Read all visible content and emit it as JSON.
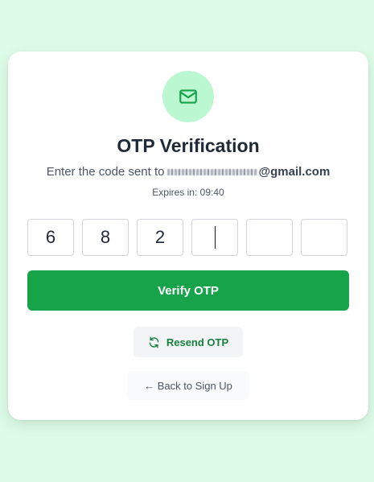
{
  "title": "OTP Verification",
  "subtitle": {
    "prefix": "Enter the code sent to",
    "email_domain": "@gmail.com"
  },
  "expires": "Expires in: 09:40",
  "otp": {
    "digits": [
      "6",
      "8",
      "2",
      "",
      "",
      ""
    ],
    "active_index": 3
  },
  "buttons": {
    "verify": "Verify OTP",
    "resend": "Resend OTP",
    "back": "← Back to Sign Up"
  },
  "icons": {
    "header": "mail-icon",
    "resend": "refresh-icon"
  },
  "colors": {
    "background": "#dcfce7",
    "accent": "#16a34a",
    "icon_circle": "#bbf7d0",
    "resend_text": "#15803d"
  }
}
